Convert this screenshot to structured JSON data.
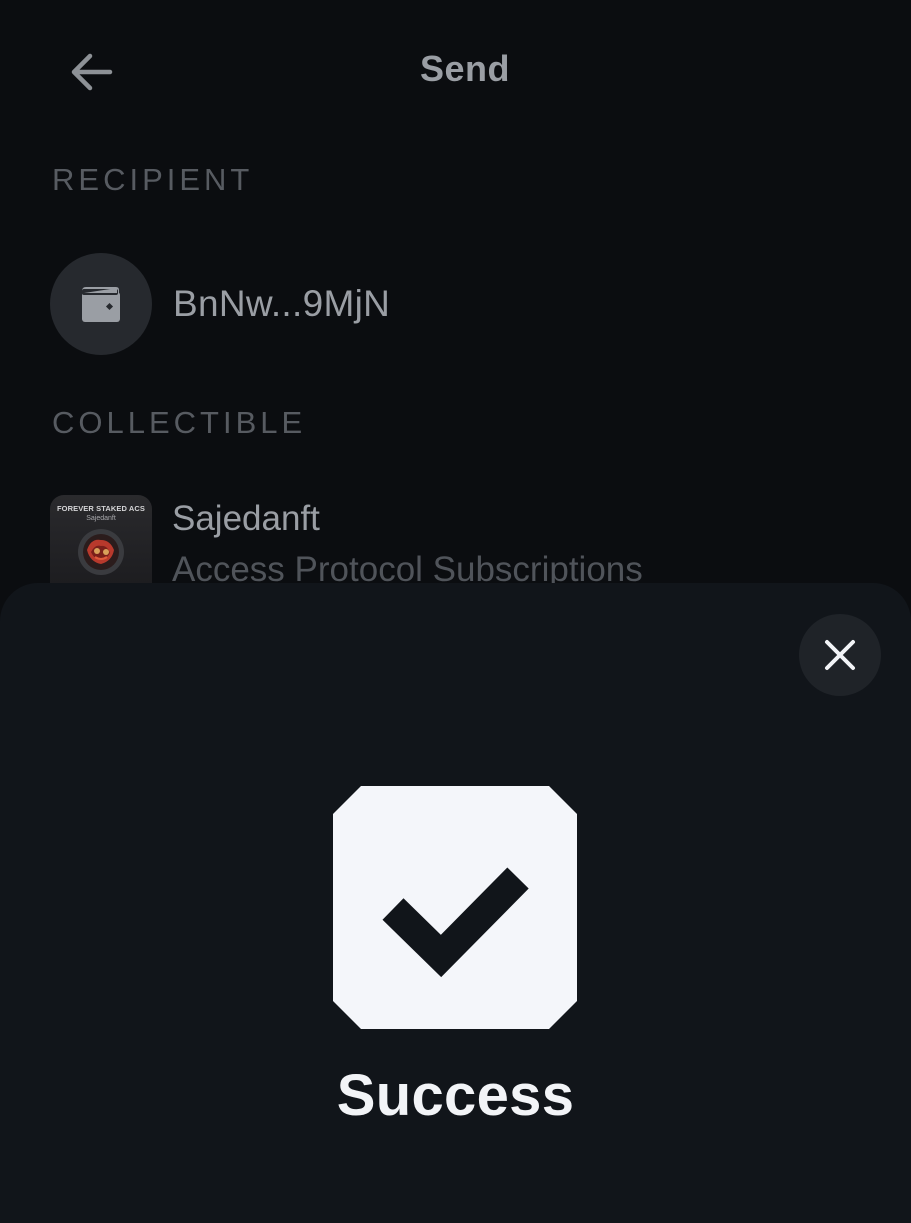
{
  "header": {
    "title": "Send",
    "back_icon": "arrow-left-icon"
  },
  "recipient": {
    "section_label": "RECIPIENT",
    "wallet_icon": "wallet-icon",
    "address": "BnNw...9MjN"
  },
  "collectible": {
    "section_label": "COLLECTIBLE",
    "thumbnail_title": "FOREVER STAKED ACS",
    "thumbnail_subtitle": "Sajedanft",
    "name": "Sajedanft",
    "collection": "Access Protocol Subscriptions"
  },
  "sheet": {
    "close_icon": "close-icon",
    "status_icon": "checkmark-icon",
    "status_text": "Success"
  },
  "colors": {
    "background": "#0b0d10",
    "sheet": "#11151a",
    "badge": "#f4f6fa",
    "muted_text": "#9a9ea4",
    "label_text": "#575b61"
  }
}
